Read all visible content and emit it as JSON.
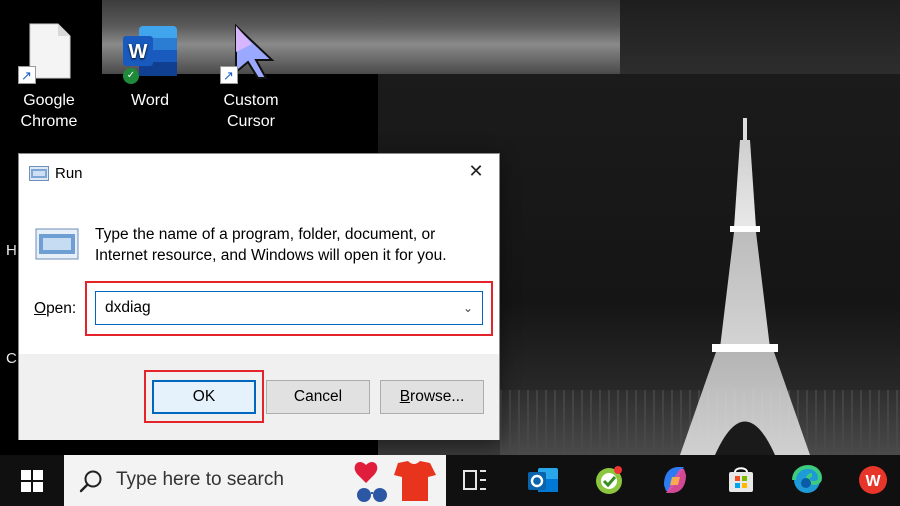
{
  "desktop": {
    "icons": [
      {
        "label_line1": "Google",
        "label_line2": "Chrome",
        "icon": "document-shortcut-icon"
      },
      {
        "label_line1": "Word",
        "label_line2": "",
        "icon": "word-icon"
      },
      {
        "label_line1": "Custom",
        "label_line2": "Cursor",
        "icon": "cursor-icon"
      }
    ],
    "edge_chars": [
      "H",
      "C"
    ]
  },
  "run_dialog": {
    "title": "Run",
    "description": "Type the name of a program, folder, document, or Internet resource, and Windows will open it for you.",
    "open_label_underlined": "O",
    "open_label_rest": "pen:",
    "open_value": "dxdiag",
    "ok_label": "OK",
    "cancel_label": "Cancel",
    "browse_label_underlined": "B",
    "browse_label_rest": "rowse...",
    "highlight_color": "#e3242b",
    "accent_color": "#0067c0"
  },
  "taskbar": {
    "search_placeholder": "Type here to search",
    "icons": [
      "task-view-icon",
      "outlook-icon",
      "app-green-icon",
      "copilot-icon",
      "store-icon",
      "edge-icon",
      "wps-office-icon"
    ]
  }
}
